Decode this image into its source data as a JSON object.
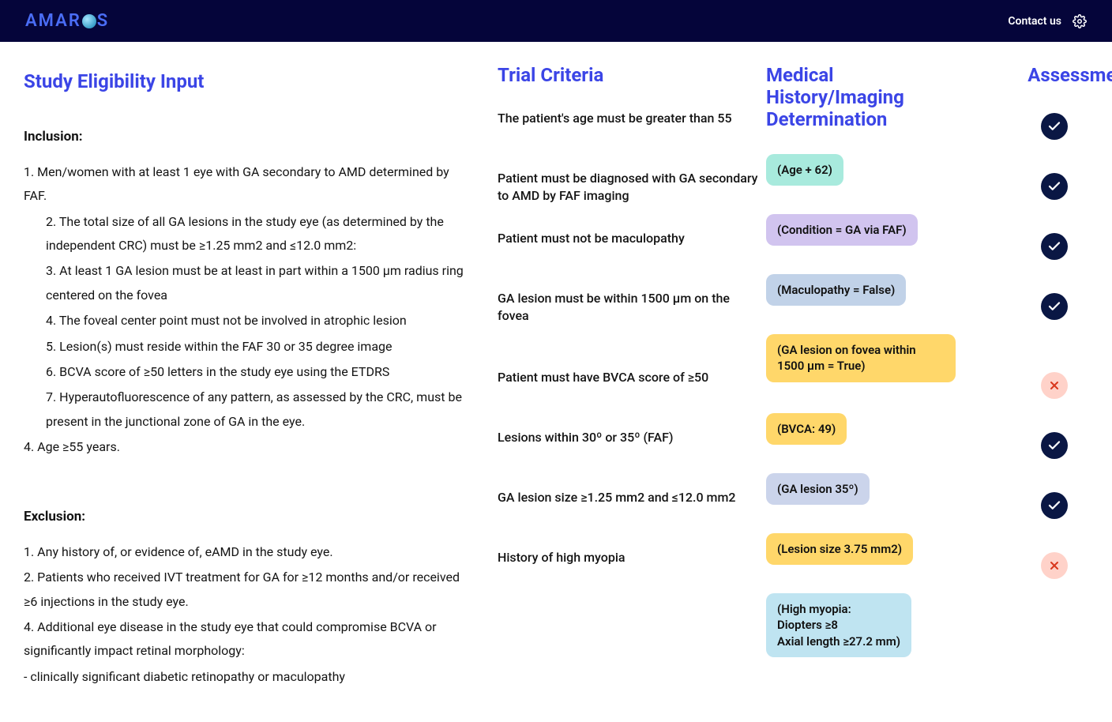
{
  "header": {
    "contact": "Contact us",
    "logo_prefix": "AMAR",
    "logo_suffix": "S"
  },
  "columns": {
    "c1": "Study Eligibility Input",
    "c2": "Trial Criteria",
    "c3": "Medical History/Imaging Determination",
    "c4": "Assessment"
  },
  "eligibility": {
    "inclusion_label": "Inclusion:",
    "inclusion": [
      " 1. Men/women with at least 1 eye with GA secondary to AMD determined by FAF.",
      " 2.  The total size of all GA lesions in the study eye (as determined by the independent CRC) must be ≥1.25 mm2 and ≤12.0 mm2:",
      "3. At least 1 GA lesion must be at least in part within a 1500 µm radius ring centered on the fovea",
      "4. The foveal center point must not be involved in atrophic lesion",
      "5.  Lesion(s) must reside within the FAF 30 or 35 degree image",
      "6. BCVA score of ≥50 letters in the study eye using the ETDRS",
      "7. Hyperautofluorescence of any pattern, as assessed by the CRC, must be present in the junctional zone of GA in the eye.",
      "4. Age ≥55 years."
    ],
    "exclusion_label": "Exclusion:",
    "exclusion": [
      "1. Any history of, or evidence of, eAMD in the study eye.",
      "2. Patients who received IVT treatment for GA for ≥12 months and/or received ≥6 injections in the study eye.",
      "4. Additional eye disease in the study eye that could compromise BCVA or significantly impact retinal morphology:",
      "- clinically significant diabetic retinopathy or maculopathy"
    ]
  },
  "rows": [
    {
      "criteria": "The patient's age must be greater than 55",
      "det": "(Age + 62)",
      "color": "teal",
      "status": "pass",
      "tall": false
    },
    {
      "criteria": "Patient must be diagnosed with GA secondary to AMD by FAF imaging",
      "det": "(Condition = GA via FAF)",
      "color": "purple",
      "status": "pass",
      "tall": false
    },
    {
      "criteria": "Patient must not be maculopathy",
      "det": "(Maculopathy = False)",
      "color": "blue1",
      "status": "pass",
      "tall": false
    },
    {
      "criteria": "GA lesion must be within 1500 µm on the fovea",
      "det": "(GA lesion on fovea within 1500 µm = True)",
      "color": "yellow",
      "status": "pass",
      "tall": true
    },
    {
      "criteria": "Patient must have BVCA score of ≥50",
      "det": "(BVCA: 49)",
      "color": "yellow",
      "status": "fail",
      "tall": false
    },
    {
      "criteria": "Lesions within 30º or 35º (FAF)",
      "det": "(GA lesion 35º)",
      "color": "blue2",
      "status": "pass",
      "tall": false
    },
    {
      "criteria": "GA lesion size ≥1.25 mm2 and ≤12.0 mm2",
      "det": "(Lesion size 3.75 mm2)",
      "color": "yellow",
      "status": "pass",
      "tall": false
    },
    {
      "criteria": "History of high myopia",
      "det": "(High myopia:\nDiopters ≥8\nAxial length ≥27.2 mm)",
      "color": "sky",
      "status": "fail",
      "tall": true
    }
  ]
}
